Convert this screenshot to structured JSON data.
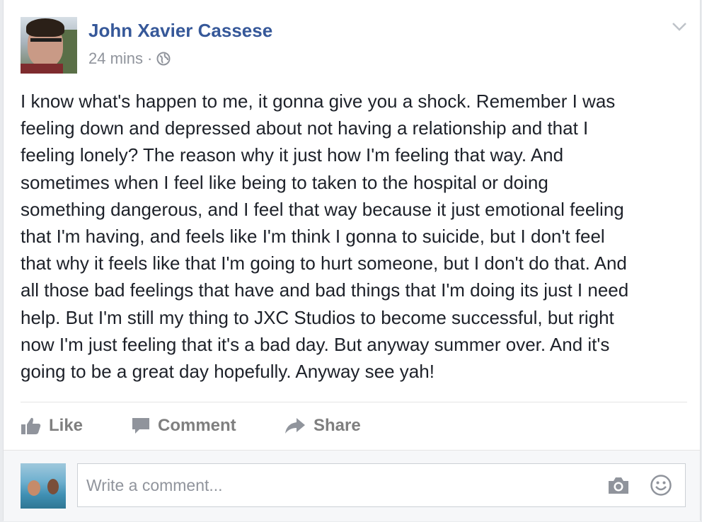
{
  "post": {
    "author": "John Xavier Cassese",
    "timestamp": "24 mins",
    "separator": "·",
    "privacy_icon": "globe-icon",
    "options_icon": "chevron-down-icon",
    "text": "I know what's happen to me, it gonna give you a shock. Remember I was\nfeeling down and depressed about not having a relationship and that I\nfeeling lonely? The reason why it just how I'm feeling that way. And\nsometimes when I feel like being to taken to the hospital or doing\nsomething dangerous, and I feel that way because it just emotional feeling\nthat I'm having, and feels like I'm think I gonna to suicide, but I don't feel\nthat why it feels like that I'm going to hurt someone, but I don't do that. And\nall those bad feelings that have and bad things that I'm doing its just I need\nhelp. But I'm still my thing to JXC Studios to become successful, but right\nnow I'm just feeling that it's a bad day. But anyway summer over. And it's\ngoing to be a great day hopefully. Anyway see yah!"
  },
  "actions": {
    "like_label": "Like",
    "comment_label": "Comment",
    "share_label": "Share",
    "like_icon": "thumbs-up-icon",
    "comment_icon": "speech-bubble-icon",
    "share_icon": "share-arrow-icon"
  },
  "comment_composer": {
    "placeholder": "Write a comment...",
    "camera_icon": "camera-icon",
    "emoji_icon": "smiley-icon"
  },
  "colors": {
    "author_link": "#365899",
    "meta_text": "#90949c",
    "body_text": "#1d2129",
    "action_text": "#7f7f7f",
    "page_bg": "#e9ebee"
  }
}
